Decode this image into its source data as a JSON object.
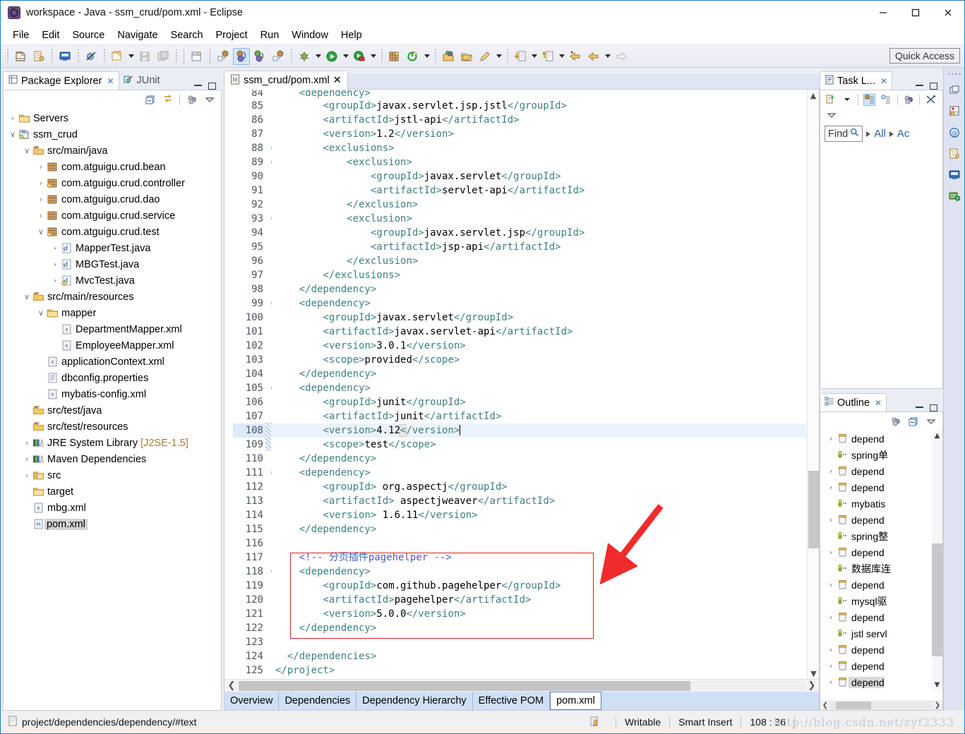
{
  "window": {
    "title": "workspace - Java - ssm_crud/pom.xml - Eclipse",
    "minimize": "—",
    "maximize": "☐",
    "close": "✕"
  },
  "menubar": [
    "File",
    "Edit",
    "Source",
    "Navigate",
    "Search",
    "Project",
    "Run",
    "Window",
    "Help"
  ],
  "toolbar": {
    "quick_access": "Quick Access"
  },
  "package_explorer": {
    "tab_label": "Package Explorer",
    "junit_tab_label": "JUnit",
    "tree": [
      {
        "indent": 0,
        "twist": "›",
        "icon": "folder-icon",
        "label": "Servers",
        "suffix": ""
      },
      {
        "indent": 0,
        "twist": "∨",
        "icon": "project-icon",
        "label": "ssm_crud",
        "suffix": ""
      },
      {
        "indent": 1,
        "twist": "∨",
        "icon": "source-folder-icon",
        "label": "src/main/java",
        "suffix": ""
      },
      {
        "indent": 2,
        "twist": "›",
        "icon": "package-icon",
        "label": "com.atguigu.crud.bean",
        "suffix": ""
      },
      {
        "indent": 2,
        "twist": "›",
        "icon": "package-warn-icon",
        "label": "com.atguigu.crud.controller",
        "suffix": ""
      },
      {
        "indent": 2,
        "twist": "›",
        "icon": "package-icon",
        "label": "com.atguigu.crud.dao",
        "suffix": ""
      },
      {
        "indent": 2,
        "twist": "›",
        "icon": "package-icon",
        "label": "com.atguigu.crud.service",
        "suffix": ""
      },
      {
        "indent": 2,
        "twist": "∨",
        "icon": "package-warn-icon",
        "label": "com.atguigu.crud.test",
        "suffix": ""
      },
      {
        "indent": 3,
        "twist": "›",
        "icon": "java-file-icon",
        "label": "MapperTest.java",
        "suffix": ""
      },
      {
        "indent": 3,
        "twist": "›",
        "icon": "java-file-icon",
        "label": "MBGTest.java",
        "suffix": ""
      },
      {
        "indent": 3,
        "twist": "›",
        "icon": "java-file-warn-icon",
        "label": "MvcTest.java",
        "suffix": ""
      },
      {
        "indent": 1,
        "twist": "∨",
        "icon": "source-folder-icon",
        "label": "src/main/resources",
        "suffix": ""
      },
      {
        "indent": 2,
        "twist": "∨",
        "icon": "folder-icon",
        "label": "mapper",
        "suffix": ""
      },
      {
        "indent": 3,
        "twist": "",
        "icon": "xml-file-icon",
        "label": "DepartmentMapper.xml",
        "suffix": ""
      },
      {
        "indent": 3,
        "twist": "",
        "icon": "xml-file-icon",
        "label": "EmployeeMapper.xml",
        "suffix": ""
      },
      {
        "indent": 2,
        "twist": "",
        "icon": "xml-file-icon",
        "label": "applicationContext.xml",
        "suffix": ""
      },
      {
        "indent": 2,
        "twist": "",
        "icon": "properties-file-icon",
        "label": "dbconfig.properties",
        "suffix": ""
      },
      {
        "indent": 2,
        "twist": "",
        "icon": "xml-file-icon",
        "label": "mybatis-config.xml",
        "suffix": ""
      },
      {
        "indent": 1,
        "twist": "",
        "icon": "source-folder-icon",
        "label": "src/test/java",
        "suffix": ""
      },
      {
        "indent": 1,
        "twist": "",
        "icon": "source-folder-icon",
        "label": "src/test/resources",
        "suffix": ""
      },
      {
        "indent": 1,
        "twist": "›",
        "icon": "library-icon",
        "label": "JRE System Library",
        "suffix": "[J2SE-1.5]"
      },
      {
        "indent": 1,
        "twist": "›",
        "icon": "library-icon",
        "label": "Maven Dependencies",
        "suffix": ""
      },
      {
        "indent": 1,
        "twist": "›",
        "icon": "folder-src-icon",
        "label": "src",
        "suffix": ""
      },
      {
        "indent": 1,
        "twist": "",
        "icon": "folder-icon",
        "label": "target",
        "suffix": ""
      },
      {
        "indent": 1,
        "twist": "",
        "icon": "xml-file-icon",
        "label": "mbg.xml",
        "suffix": ""
      },
      {
        "indent": 1,
        "twist": "",
        "icon": "maven-file-icon",
        "label": "pom.xml",
        "suffix": "",
        "selected": true
      }
    ]
  },
  "editor": {
    "tab_label": "ssm_crud/pom.xml",
    "first_partial_line_no": "84",
    "first_partial_line_text": "<dependency>",
    "lines": [
      {
        "n": "85",
        "fold": false,
        "hl": false,
        "html": "        <span class='tag'>&lt;groupId&gt;</span><span class='txt'>javax.servlet.jsp.jstl</span><span class='tag'>&lt;/groupId&gt;</span>"
      },
      {
        "n": "86",
        "fold": false,
        "hl": false,
        "html": "        <span class='tag'>&lt;artifactId&gt;</span><span class='txt'>jstl-api</span><span class='tag'>&lt;/artifactId&gt;</span>"
      },
      {
        "n": "87",
        "fold": false,
        "hl": false,
        "html": "        <span class='tag'>&lt;version&gt;</span><span class='txt'>1.2</span><span class='tag'>&lt;/version&gt;</span>"
      },
      {
        "n": "88",
        "fold": true,
        "hl": false,
        "html": "        <span class='tag'>&lt;exclusions&gt;</span>"
      },
      {
        "n": "89",
        "fold": true,
        "hl": false,
        "html": "            <span class='tag'>&lt;exclusion&gt;</span>"
      },
      {
        "n": "90",
        "fold": false,
        "hl": false,
        "html": "                <span class='tag'>&lt;groupId&gt;</span><span class='txt'>javax.servlet</span><span class='tag'>&lt;/groupId&gt;</span>"
      },
      {
        "n": "91",
        "fold": false,
        "hl": false,
        "html": "                <span class='tag'>&lt;artifactId&gt;</span><span class='txt'>servlet-api</span><span class='tag'>&lt;/artifactId&gt;</span>"
      },
      {
        "n": "92",
        "fold": false,
        "hl": false,
        "html": "            <span class='tag'>&lt;/exclusion&gt;</span>"
      },
      {
        "n": "93",
        "fold": true,
        "hl": false,
        "html": "            <span class='tag'>&lt;exclusion&gt;</span>"
      },
      {
        "n": "94",
        "fold": false,
        "hl": false,
        "html": "                <span class='tag'>&lt;groupId&gt;</span><span class='txt'>javax.servlet.jsp</span><span class='tag'>&lt;/groupId&gt;</span>"
      },
      {
        "n": "95",
        "fold": false,
        "hl": false,
        "html": "                <span class='tag'>&lt;artifactId&gt;</span><span class='txt'>jsp-api</span><span class='tag'>&lt;/artifactId&gt;</span>"
      },
      {
        "n": "96",
        "fold": false,
        "hl": false,
        "html": "            <span class='tag'>&lt;/exclusion&gt;</span>"
      },
      {
        "n": "97",
        "fold": false,
        "hl": false,
        "html": "        <span class='tag'>&lt;/exclusions&gt;</span>"
      },
      {
        "n": "98",
        "fold": false,
        "hl": false,
        "html": "    <span class='tag'>&lt;/dependency&gt;</span>"
      },
      {
        "n": "99",
        "fold": true,
        "hl": false,
        "html": "    <span class='tag'>&lt;dependency&gt;</span>"
      },
      {
        "n": "100",
        "fold": false,
        "hl": false,
        "html": "        <span class='tag'>&lt;groupId&gt;</span><span class='txt'>javax.servlet</span><span class='tag'>&lt;/groupId&gt;</span>"
      },
      {
        "n": "101",
        "fold": false,
        "hl": false,
        "html": "        <span class='tag'>&lt;artifactId&gt;</span><span class='txt'>javax.servlet-api</span><span class='tag'>&lt;/artifactId&gt;</span>"
      },
      {
        "n": "102",
        "fold": false,
        "hl": false,
        "html": "        <span class='tag'>&lt;version&gt;</span><span class='txt'>3.0.1</span><span class='tag'>&lt;/version&gt;</span>"
      },
      {
        "n": "103",
        "fold": false,
        "hl": false,
        "html": "        <span class='tag'>&lt;scope&gt;</span><span class='txt'>provided</span><span class='tag'>&lt;/scope&gt;</span>"
      },
      {
        "n": "104",
        "fold": false,
        "hl": false,
        "html": "    <span class='tag'>&lt;/dependency&gt;</span>"
      },
      {
        "n": "105",
        "fold": true,
        "hl": false,
        "html": "    <span class='tag'>&lt;dependency&gt;</span>"
      },
      {
        "n": "106",
        "fold": false,
        "hl": false,
        "html": "        <span class='tag'>&lt;groupId&gt;</span><span class='txt'>junit</span><span class='tag'>&lt;/groupId&gt;</span>"
      },
      {
        "n": "107",
        "fold": false,
        "hl": false,
        "html": "        <span class='tag'>&lt;artifactId&gt;</span><span class='txt'>junit</span><span class='tag'>&lt;/artifactId&gt;</span>"
      },
      {
        "n": "108",
        "fold": false,
        "hl": true,
        "html": "        <span class='tag'>&lt;version&gt;</span><span class='txt'>4.12</span><span class='tag selbox'>&lt;</span><span class='tag'>/version&gt;</span><span class='caret'></span>"
      },
      {
        "n": "109",
        "fold": false,
        "hl": false,
        "html": "        <span class='tag'>&lt;scope&gt;</span><span class='txt'>test</span><span class='tag'>&lt;/scope&gt;</span>"
      },
      {
        "n": "110",
        "fold": false,
        "hl": false,
        "html": "    <span class='tag'>&lt;/dependency&gt;</span>"
      },
      {
        "n": "111",
        "fold": true,
        "hl": false,
        "html": "    <span class='tag'>&lt;dependency&gt;</span>"
      },
      {
        "n": "112",
        "fold": false,
        "hl": false,
        "html": "        <span class='tag'>&lt;groupId&gt;</span><span class='txt'> org.aspectj</span><span class='tag'>&lt;/groupId&gt;</span>"
      },
      {
        "n": "113",
        "fold": false,
        "hl": false,
        "html": "        <span class='tag'>&lt;artifactId&gt;</span><span class='txt'> aspectjweaver</span><span class='tag'>&lt;/artifactId&gt;</span>"
      },
      {
        "n": "114",
        "fold": false,
        "hl": false,
        "html": "        <span class='tag'>&lt;version&gt;</span><span class='txt'> 1.6.11</span><span class='tag'>&lt;/version&gt;</span>"
      },
      {
        "n": "115",
        "fold": false,
        "hl": false,
        "html": "    <span class='tag'>&lt;/dependency&gt;</span>"
      },
      {
        "n": "116",
        "fold": false,
        "hl": false,
        "html": ""
      },
      {
        "n": "117",
        "fold": false,
        "hl": false,
        "html": "    <span class='cmt'>&lt;!-- 分页插件pagehelper --&gt;</span>"
      },
      {
        "n": "118",
        "fold": true,
        "hl": false,
        "html": "    <span class='tag'>&lt;dependency&gt;</span>"
      },
      {
        "n": "119",
        "fold": false,
        "hl": false,
        "html": "        <span class='tag'>&lt;groupId&gt;</span><span class='txt'>com.github.pagehelper</span><span class='tag'>&lt;/groupId&gt;</span>"
      },
      {
        "n": "120",
        "fold": false,
        "hl": false,
        "html": "        <span class='tag'>&lt;artifactId&gt;</span><span class='txt'>pagehelper</span><span class='tag'>&lt;/artifactId&gt;</span>"
      },
      {
        "n": "121",
        "fold": false,
        "hl": false,
        "html": "        <span class='tag'>&lt;version&gt;</span><span class='txt'>5.0.0</span><span class='tag'>&lt;/version&gt;</span>"
      },
      {
        "n": "122",
        "fold": false,
        "hl": false,
        "html": "    <span class='tag'>&lt;/dependency&gt;</span>"
      },
      {
        "n": "123",
        "fold": false,
        "hl": false,
        "html": ""
      },
      {
        "n": "124",
        "fold": false,
        "hl": false,
        "html": "  <span class='tag'>&lt;/dependencies&gt;</span>"
      },
      {
        "n": "125",
        "fold": false,
        "hl": false,
        "html": "<span class='tag'>&lt;/project&gt;</span>"
      }
    ],
    "page_tabs": [
      "Overview",
      "Dependencies",
      "Dependency Hierarchy",
      "Effective POM",
      "pom.xml"
    ],
    "active_page_tab": "pom.xml"
  },
  "task_list": {
    "tab_label": "Task L...",
    "find_placeholder": "Find",
    "filter_all": "All",
    "filter_activate": "Ac"
  },
  "outline": {
    "tab_label": "Outline",
    "rows": [
      {
        "twist": "›",
        "icon": "dependency-icon",
        "label": "depend"
      },
      {
        "twist": "",
        "icon": "comment-icon",
        "label": "spring单"
      },
      {
        "twist": "›",
        "icon": "dependency-icon",
        "label": "depend"
      },
      {
        "twist": "›",
        "icon": "dependency-icon",
        "label": "depend"
      },
      {
        "twist": "",
        "icon": "comment-icon",
        "label": "mybatis"
      },
      {
        "twist": "›",
        "icon": "dependency-icon",
        "label": "depend"
      },
      {
        "twist": "",
        "icon": "comment-icon",
        "label": "spring整"
      },
      {
        "twist": "›",
        "icon": "dependency-icon",
        "label": "depend"
      },
      {
        "twist": "",
        "icon": "comment-icon",
        "label": "数据库连"
      },
      {
        "twist": "›",
        "icon": "dependency-icon",
        "label": "depend"
      },
      {
        "twist": "",
        "icon": "comment-icon",
        "label": "mysql驱"
      },
      {
        "twist": "›",
        "icon": "dependency-icon",
        "label": "depend"
      },
      {
        "twist": "",
        "icon": "comment-icon",
        "label": "jstl servl"
      },
      {
        "twist": "›",
        "icon": "dependency-icon",
        "label": "depend"
      },
      {
        "twist": "›",
        "icon": "dependency-icon",
        "label": "depend"
      },
      {
        "twist": "›",
        "icon": "dependency-icon",
        "label": "depend",
        "selected": true
      }
    ]
  },
  "statusbar": {
    "path": "project/dependencies/dependency/#text",
    "writable": "Writable",
    "insert_mode": "Smart Insert",
    "position": "108 : 36",
    "watermark": "http://blog.csdn.net/zyf2333"
  }
}
